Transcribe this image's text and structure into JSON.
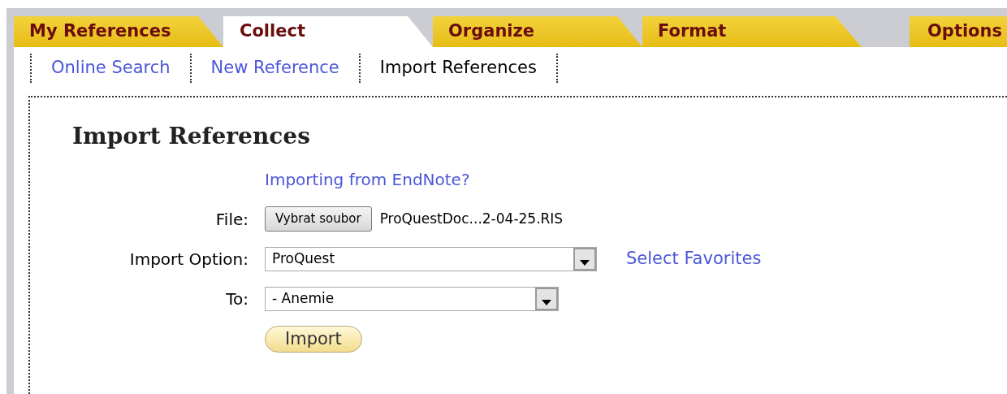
{
  "tabs": [
    {
      "label": "My References",
      "selected": false
    },
    {
      "label": "Collect",
      "selected": true
    },
    {
      "label": "Organize",
      "selected": false
    },
    {
      "label": "Format",
      "selected": false
    },
    {
      "label": "Options",
      "selected": false
    }
  ],
  "subnav": [
    {
      "label": "Online Search",
      "selected": false
    },
    {
      "label": "New Reference",
      "selected": false
    },
    {
      "label": "Import References",
      "selected": true
    }
  ],
  "heading": "Import References",
  "endnote_link": "Importing from EndNote?",
  "file": {
    "label": "File:",
    "button": "Vybrat soubor",
    "filename": "ProQuestDoc...2-04-25.RIS"
  },
  "import_option": {
    "label": "Import Option:",
    "value": "ProQuest",
    "link": "Select Favorites"
  },
  "to": {
    "label": "To:",
    "value": "- Anemie"
  },
  "submit": "Import"
}
